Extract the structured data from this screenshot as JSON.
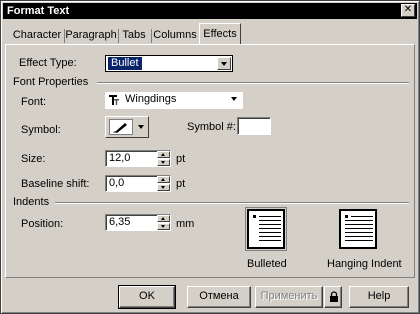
{
  "window": {
    "title": "Format Text",
    "close_glyph": "✕"
  },
  "tabs": [
    {
      "label": "Character"
    },
    {
      "label": "Paragraph"
    },
    {
      "label": "Tabs"
    },
    {
      "label": "Columns"
    },
    {
      "label": "Effects",
      "active": true
    }
  ],
  "effect_type": {
    "label": "Effect Type:",
    "value": "Bullet"
  },
  "font_properties": {
    "heading": "Font Properties",
    "font_label": "Font:",
    "font_icon": "truetype-icon",
    "font_value": "Wingdings",
    "symbol_label": "Symbol:",
    "symbol_icon": "pen-nib-icon",
    "symbol_num_label": "Symbol #:",
    "symbol_num_value": "",
    "size_label": "Size:",
    "size_value": "12,0",
    "size_unit": "pt",
    "baseline_label": "Baseline shift:",
    "baseline_value": "0,0",
    "baseline_unit": "pt"
  },
  "indents": {
    "heading": "Indents",
    "position_label": "Position:",
    "position_value": "6,35",
    "position_unit": "mm",
    "options": [
      {
        "label": "Bulleted",
        "selected": true
      },
      {
        "label": "Hanging Indent",
        "selected": false
      }
    ]
  },
  "buttons": {
    "ok": "OK",
    "cancel": "Отмена",
    "apply": "Применить",
    "help": "Help",
    "lock_icon": "lock-icon"
  },
  "colors": {
    "titlebar": "#000000",
    "face": "#d4d0c8",
    "selection": "#0a246a"
  }
}
